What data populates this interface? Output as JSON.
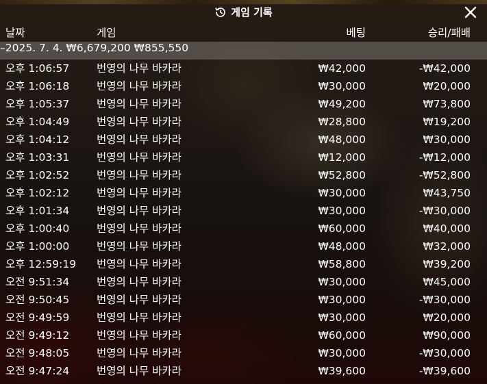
{
  "header": {
    "title": "게임 기록",
    "history_icon": "history-icon",
    "close_icon": "close-icon"
  },
  "columns": {
    "date": "날짜",
    "game": "게임",
    "bet": "베팅",
    "result": "승리/패배"
  },
  "summary": {
    "date": "–2025. 7. 4.",
    "bet": "₩6,679,200",
    "result": "₩855,550"
  },
  "rows": [
    {
      "time": "오후 1:06:57",
      "game": "번영의 나무 바카라",
      "bet": "₩42,000",
      "result": "-₩42,000"
    },
    {
      "time": "오후 1:06:18",
      "game": "번영의 나무 바카라",
      "bet": "₩30,000",
      "result": "₩20,000"
    },
    {
      "time": "오후 1:05:37",
      "game": "번영의 나무 바카라",
      "bet": "₩49,200",
      "result": "₩73,800"
    },
    {
      "time": "오후 1:04:49",
      "game": "번영의 나무 바카라",
      "bet": "₩28,800",
      "result": "₩19,200"
    },
    {
      "time": "오후 1:04:12",
      "game": "번영의 나무 바카라",
      "bet": "₩48,000",
      "result": "₩30,000"
    },
    {
      "time": "오후 1:03:31",
      "game": "번영의 나무 바카라",
      "bet": "₩12,000",
      "result": "-₩12,000"
    },
    {
      "time": "오후 1:02:52",
      "game": "번영의 나무 바카라",
      "bet": "₩52,800",
      "result": "-₩52,800"
    },
    {
      "time": "오후 1:02:12",
      "game": "번영의 나무 바카라",
      "bet": "₩30,000",
      "result": "₩43,750"
    },
    {
      "time": "오후 1:01:34",
      "game": "번영의 나무 바카라",
      "bet": "₩30,000",
      "result": "-₩30,000"
    },
    {
      "time": "오후 1:00:40",
      "game": "번영의 나무 바카라",
      "bet": "₩60,000",
      "result": "₩40,000"
    },
    {
      "time": "오후 1:00:00",
      "game": "번영의 나무 바카라",
      "bet": "₩48,000",
      "result": "₩32,000"
    },
    {
      "time": "오후 12:59:19",
      "game": "번영의 나무 바카라",
      "bet": "₩58,800",
      "result": "₩39,200"
    },
    {
      "time": "오전 9:51:34",
      "game": "번영의 나무 바카라",
      "bet": "₩30,000",
      "result": "₩45,000"
    },
    {
      "time": "오전 9:50:45",
      "game": "번영의 나무 바카라",
      "bet": "₩30,000",
      "result": "-₩30,000"
    },
    {
      "time": "오전 9:49:59",
      "game": "번영의 나무 바카라",
      "bet": "₩30,000",
      "result": "₩20,000"
    },
    {
      "time": "오전 9:49:12",
      "game": "번영의 나무 바카라",
      "bet": "₩60,000",
      "result": "₩90,000"
    },
    {
      "time": "오전 9:48:05",
      "game": "번영의 나무 바카라",
      "bet": "₩30,000",
      "result": "-₩30,000"
    },
    {
      "time": "오전 9:47:24",
      "game": "번영의 나무 바카라",
      "bet": "₩39,600",
      "result": "-₩39,600"
    }
  ]
}
